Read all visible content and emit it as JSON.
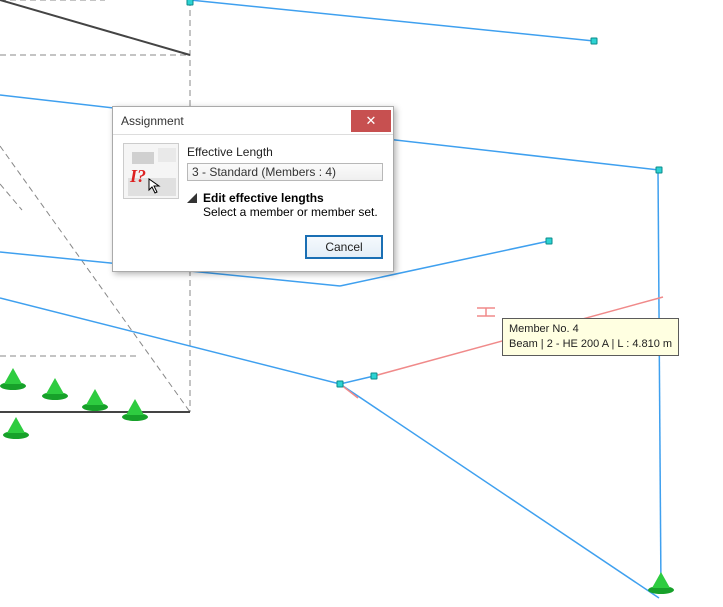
{
  "dialog": {
    "title": "Assignment",
    "section_label": "Effective Length",
    "selection": "3 - Standard (Members : 4)",
    "instruction_bold": "Edit effective lengths",
    "instruction_text": "Select a member or member set.",
    "cancel_label": "Cancel"
  },
  "tooltip": {
    "line1": "Member No. 4",
    "line2": "Beam | 2 - HE 200 A | L : 4.810 m"
  }
}
